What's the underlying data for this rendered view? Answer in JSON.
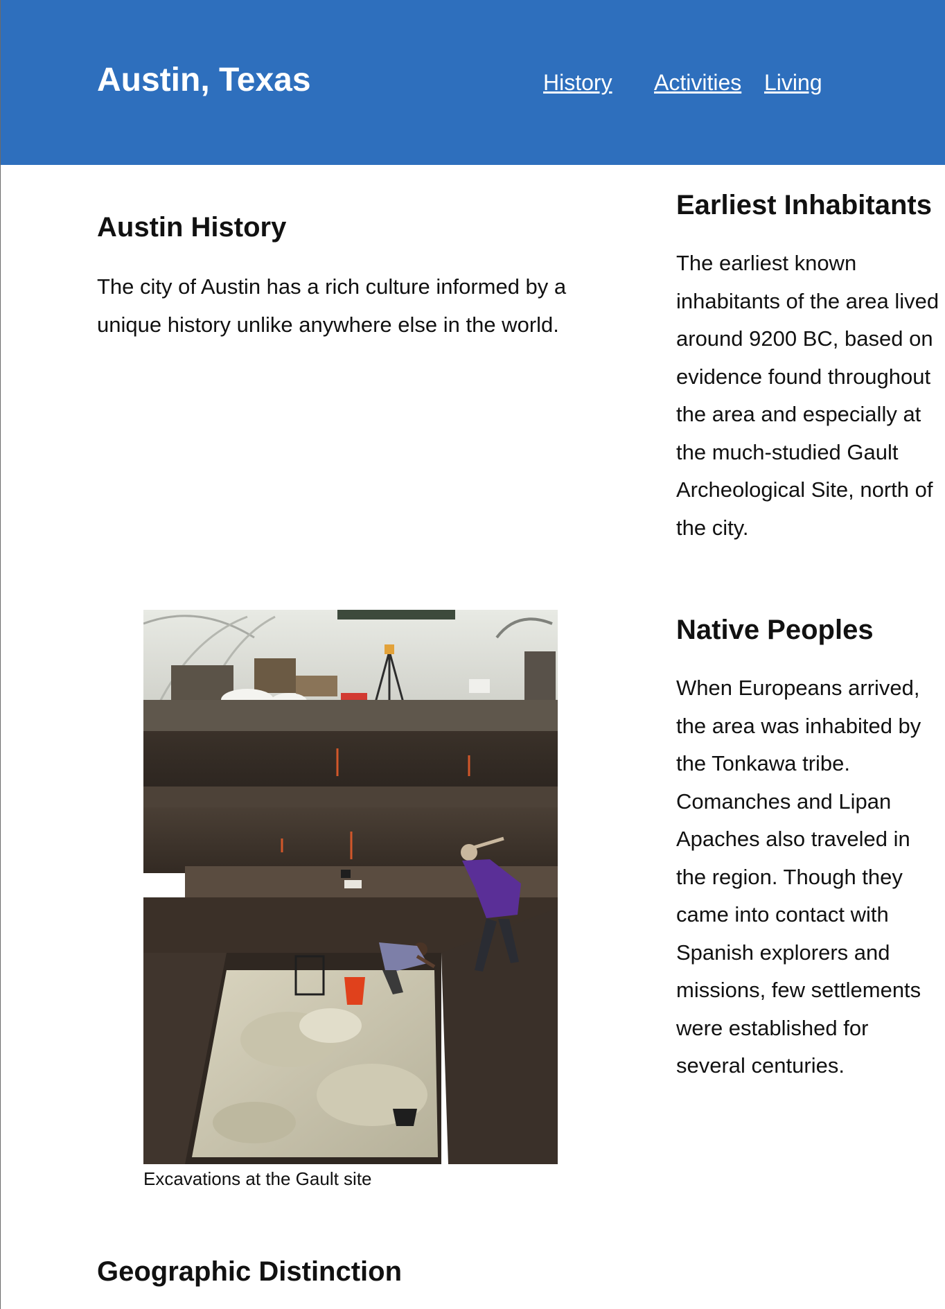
{
  "header": {
    "title": "Austin, Texas",
    "nav": {
      "history": "History",
      "activities": "Activities",
      "living": "Living"
    },
    "background_color": "#2e6fbd"
  },
  "main": {
    "history_heading": "Austin History",
    "history_text": "The city of Austin has a rich culture informed by a unique history unlike anywhere else in the world.",
    "figure_caption": "Excavations at the Gault site",
    "geography_heading": "Geographic Distinction"
  },
  "aside": {
    "earliest_heading": "Earliest Inhabitants",
    "earliest_lines": [
      "The earliest known",
      "inhabitants of the area lived",
      "around 9200 BC, based on",
      "evidence found throughout",
      "the area and especially at",
      "the much-studied Gault",
      "Archeological Site, north of",
      "the city."
    ],
    "native_heading": "Native Peoples",
    "native_lines": [
      "When Europeans arrived,",
      "the area was inhabited by",
      "the Tonkawa tribe.",
      "Comanches and Lipan",
      "Apaches also traveled in",
      "the region. Though they",
      "came into contact with",
      "Spanish explorers and",
      "missions, few settlements",
      "were established for",
      "several centuries."
    ]
  }
}
